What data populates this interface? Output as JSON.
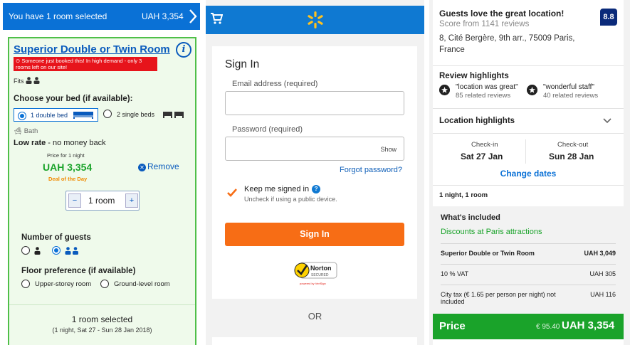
{
  "booking": {
    "summary_bar": {
      "selected_text": "You have 1 room selected",
      "price": "UAH 3,354"
    },
    "room": {
      "title": "Superior Double or Twin Room",
      "alert": "Someone just booked this! In high demand - only 3 rooms left on our site!",
      "fits_label": "Fits",
      "choose_bed_label": "Choose your bed (if available):",
      "bed_options": [
        "1 double bed",
        "2 single beds"
      ],
      "bath_label": "Bath",
      "rate_bold": "Low rate",
      "rate_rest": " - no money back",
      "price_for": "Price for 1 night",
      "price": "UAH 3,354",
      "deal": "Deal of the Day",
      "remove_label": "Remove",
      "quantity": "1 room",
      "guests_label": "Number of guests",
      "floor_label": "Floor preference (if available)",
      "floor_options": [
        "Upper-storey room",
        "Ground-level room"
      ],
      "selected_summary": "1 room selected",
      "selected_dates": "(1 night, Sat 27 - Sun 28 Jan 2018)"
    }
  },
  "signin": {
    "title": "Sign In",
    "email_label": "Email address (required)",
    "password_label": "Password (required)",
    "show_label": "Show",
    "forgot_label": "Forgot password?",
    "keep_signed_label": "Keep me signed in",
    "keep_signed_help": "?",
    "uncheck_hint": "Uncheck if using a public device.",
    "button_label": "Sign In",
    "norton_brand": "Norton",
    "norton_sub": "SECURED",
    "norton_powered": "powered by VeriSign",
    "or_label": "OR",
    "colors": {
      "header": "#0f79d2",
      "button": "#f76d15",
      "spark": "#ffc220"
    }
  },
  "hotel": {
    "guests_love": "Guests love the great location!",
    "score_text": "Score from 1141 reviews",
    "score": "8.8",
    "address": "8, Cité Bergère, 9th arr., 75009 Paris, France",
    "review_highlights_label": "Review highlights",
    "reviews": [
      {
        "title": "\"location was great\"",
        "count": "85 related reviews"
      },
      {
        "title": "\"wonderful staff\"",
        "count": "40 related reviews"
      }
    ],
    "location_highlights_label": "Location highlights",
    "checkin_label": "Check-in",
    "checkin_value": "Sat 27 Jan",
    "checkout_label": "Check-out",
    "checkout_value": "Sun 28 Jan",
    "change_dates_label": "Change dates",
    "nights_label": "1 night, 1 room",
    "included_label": "What's included",
    "discounts_label": "Discounts at Paris attractions",
    "lines": [
      {
        "label": "Superior Double or Twin Room",
        "value": "UAH 3,049"
      },
      {
        "label": "10 % VAT",
        "value": "UAH 305"
      },
      {
        "label": "City tax (€ 1.65 per person per night) not included",
        "value": "UAH 116"
      }
    ],
    "price_label": "Price",
    "price_eur": "€ 95.40",
    "price_uah": "UAH 3,354"
  }
}
